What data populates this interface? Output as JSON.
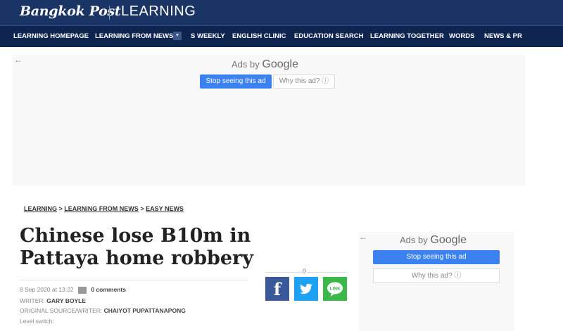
{
  "header": {
    "brand": "Bangkok Post",
    "section": "LEARNING"
  },
  "nav": {
    "items": [
      "LEARNING HOMEPAGE",
      "LEARNING FROM NEWS",
      "S WEEKLY",
      "ENGLISH CLINIC",
      "EDUCATION SEARCH",
      "LEARNING TOGETHER",
      "WORDS",
      "NEWS & PR"
    ],
    "dropdown_icon": "chevron-down-icon"
  },
  "ad_top": {
    "back": "←",
    "ads_by": "Ads by",
    "google": "Google",
    "stop": "Stop seeing this ad",
    "why": "Why this ad? ⓘ"
  },
  "breadcrumb": {
    "items": [
      "LEARNING",
      "LEARNING FROM NEWS",
      "EASY NEWS"
    ],
    "separator": ">"
  },
  "article": {
    "title": "Chinese lose B10m in Pattaya home robbery",
    "date": "8 Sep 2020 at 13:22",
    "comments": "0 comments",
    "writer_label": "WRITER:",
    "writer": "GARY BOYLE",
    "source_label": "ORIGINAL SOURCE/WRITER:",
    "source": "CHAIYOT PUPATTANAPONG",
    "level_label": "Level switch:"
  },
  "share": {
    "count": "0",
    "facebook": "f",
    "line": "LINE"
  },
  "ad_side": {
    "back": "←",
    "ads_by": "Ads by",
    "google": "Google",
    "stop": "Stop seeing this ad",
    "why": "Why this ad? ⓘ"
  },
  "colors": {
    "header_bg": "#1a3466",
    "nav_bg": "#0e2550",
    "ad_button": "#3b82f0",
    "facebook": "#3b5998",
    "twitter": "#1da1f2",
    "line": "#3cb84b"
  }
}
